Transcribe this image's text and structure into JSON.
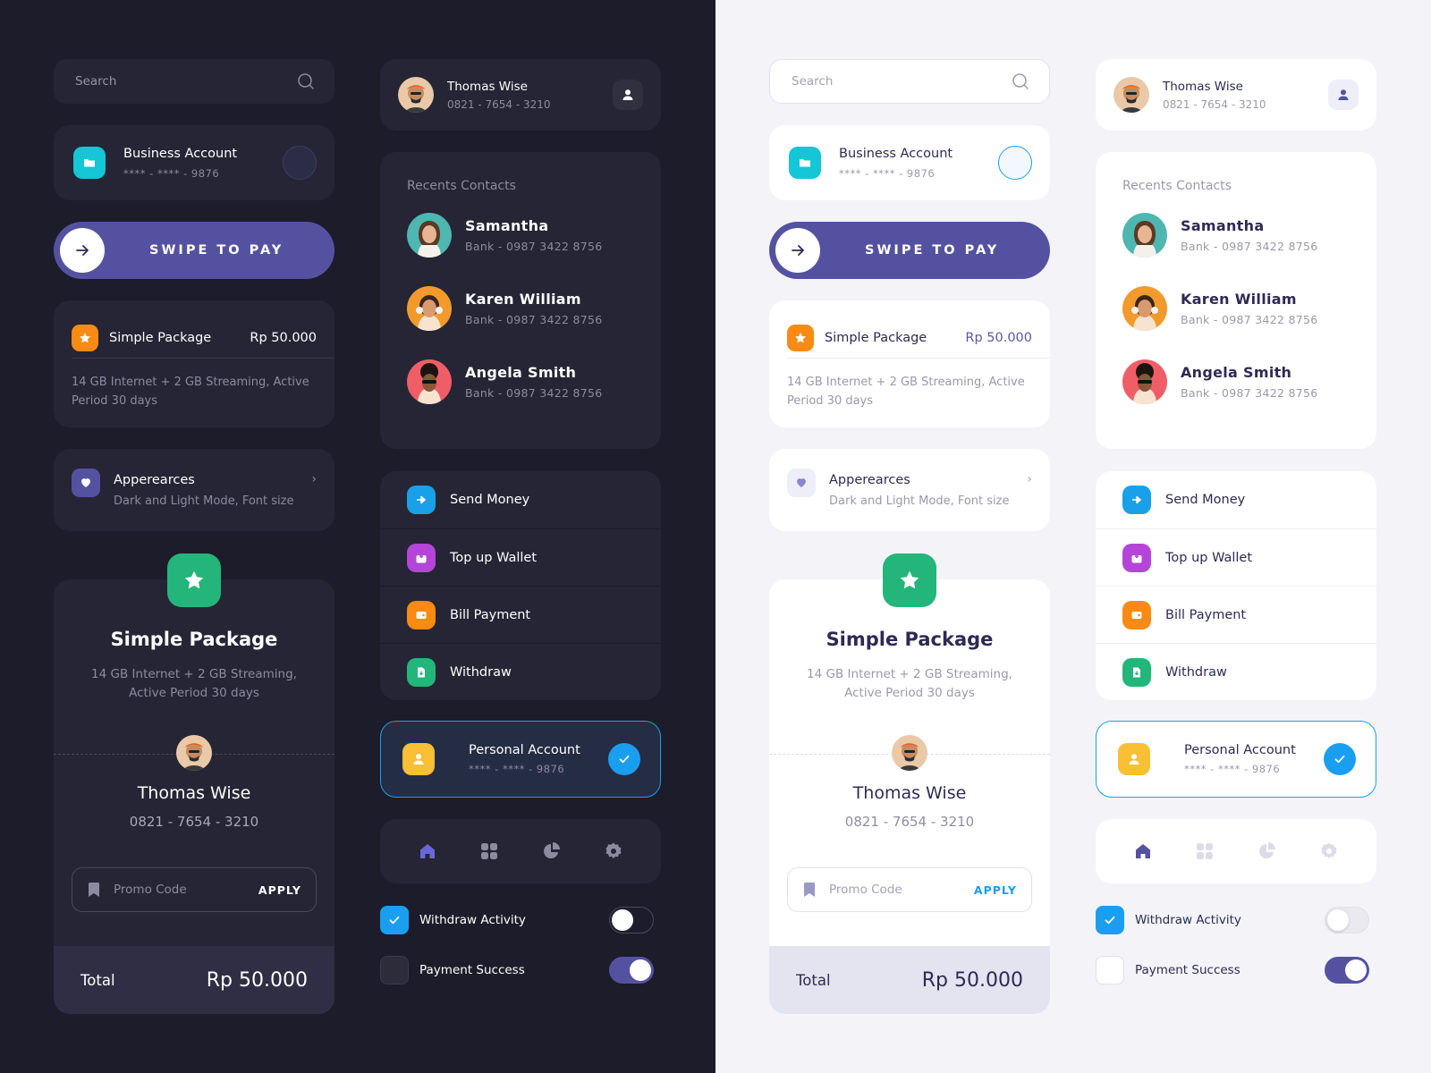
{
  "search": {
    "placeholder": "Search"
  },
  "business_account": {
    "title": "Business Account",
    "number": "**** - **** - 9876"
  },
  "swipe": {
    "label": "SWIPE TO PAY"
  },
  "simple_package_card": {
    "name": "Simple Package",
    "price": "Rp 50.000",
    "description": "14 GB Internet + 2 GB Streaming, Active Period 30 days"
  },
  "appearances": {
    "title": "Apperearces",
    "subtitle": "Dark and Light Mode, Font size"
  },
  "ticket": {
    "title": "Simple Package",
    "description": "14 GB Internet + 2 GB Streaming, Active Period 30 days",
    "name": "Thomas Wise",
    "phone": "0821 - 7654 - 3210",
    "promo_placeholder": "Promo Code",
    "apply_label": "APPLY",
    "total_label": "Total",
    "total_value": "Rp 50.000"
  },
  "profile": {
    "name": "Thomas Wise",
    "phone": "0821 - 7654 - 3210"
  },
  "contacts": {
    "header": "Recents Contacts",
    "items": [
      {
        "name": "Samantha",
        "sub": "Bank - 0987 3422 8756"
      },
      {
        "name": "Karen William",
        "sub": "Bank - 0987 3422 8756"
      },
      {
        "name": "Angela Smith",
        "sub": "Bank - 0987 3422 8756"
      }
    ]
  },
  "menu": {
    "items": [
      {
        "label": "Send Money",
        "icon": "send-icon",
        "color": "#1aa0e8"
      },
      {
        "label": "Top up Wallet",
        "icon": "wallet-icon",
        "color": "#b545d8"
      },
      {
        "label": "Bill Payment",
        "icon": "bill-icon",
        "color": "#f98a12"
      },
      {
        "label": "Withdraw",
        "icon": "withdraw-icon",
        "color": "#24b57a"
      }
    ]
  },
  "personal_account": {
    "title": "Personal Account",
    "number": "**** - **** - 9876"
  },
  "tabbar": {
    "items": [
      "home-icon",
      "grid-icon",
      "pie-chart-icon",
      "settings-icon"
    ],
    "active": 0
  },
  "toggles": [
    {
      "label": "Withdraw Activity",
      "checked": true,
      "switch_on": false
    },
    {
      "label": "Payment Success",
      "checked": false,
      "switch_on": true
    }
  ],
  "colors": {
    "dark_bg": "#1d1c2a",
    "dark_card": "#252535",
    "light_bg": "#f3f3f8",
    "accent": "#5452a0",
    "blue": "#1a9ff0",
    "orange": "#f98a12",
    "green": "#24b57a",
    "cyan": "#14c6d6",
    "yellow": "#f9bf35"
  }
}
